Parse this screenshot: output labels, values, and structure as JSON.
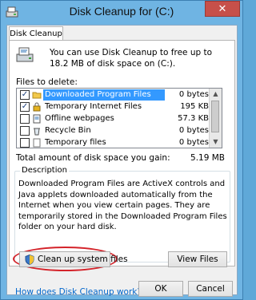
{
  "window": {
    "title": "Disk Cleanup for  (C:)",
    "close_glyph": "✕"
  },
  "tab": {
    "label": "Disk Cleanup"
  },
  "intro": {
    "text": "You can use Disk Cleanup to free up to 18.2 MB of disk space on  (C:)."
  },
  "files": {
    "label": "Files to delete:",
    "items": [
      {
        "name": "Downloaded Program Files",
        "size": "0 bytes",
        "checked": true,
        "selected": true,
        "icon": "folder-icon"
      },
      {
        "name": "Temporary Internet Files",
        "size": "195 KB",
        "checked": true,
        "selected": false,
        "icon": "lock-icon"
      },
      {
        "name": "Offline webpages",
        "size": "57.3 KB",
        "checked": false,
        "selected": false,
        "icon": "page-icon"
      },
      {
        "name": "Recycle Bin",
        "size": "0 bytes",
        "checked": false,
        "selected": false,
        "icon": "recycle-bin-icon"
      },
      {
        "name": "Temporary files",
        "size": "0 bytes",
        "checked": false,
        "selected": false,
        "icon": "file-icon"
      }
    ],
    "check_glyph": "✓"
  },
  "total": {
    "label": "Total amount of disk space you gain:",
    "value": "5.19 MB"
  },
  "description": {
    "title": "Description",
    "text": "Downloaded Program Files are ActiveX controls and Java applets downloaded automatically from the Internet when you view certain pages. They are temporarily stored in the Downloaded Program Files folder on your hard disk."
  },
  "buttons": {
    "cleanup_system": "Clean up system files",
    "view_files": "View Files",
    "ok": "OK",
    "cancel": "Cancel"
  },
  "help_link": "How does Disk Cleanup work?",
  "colors": {
    "highlight": "#d4232a",
    "selection": "#3399ff",
    "link": "#0066cc"
  }
}
